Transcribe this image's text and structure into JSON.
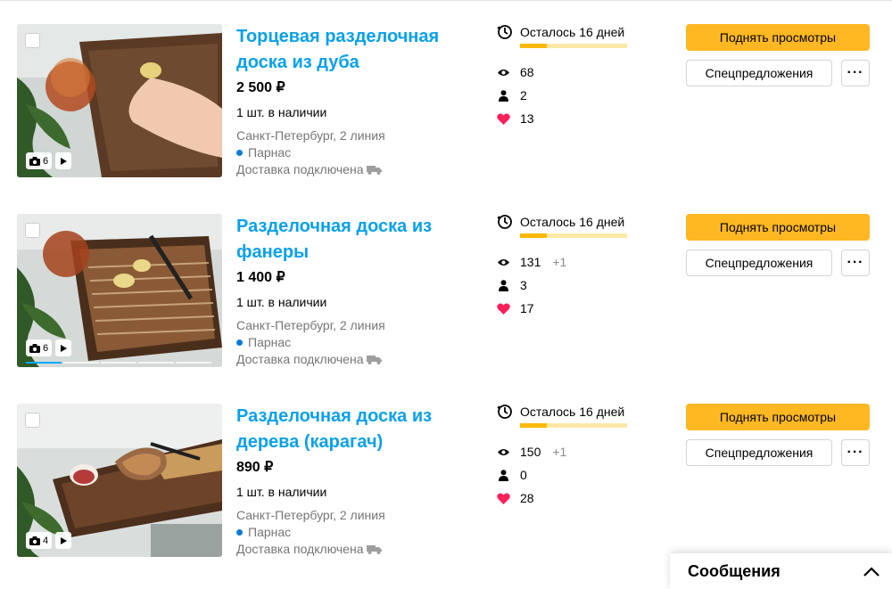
{
  "listings": [
    {
      "title": "Торцевая разделочная доска из дуба",
      "price": "2 500 ₽",
      "quantity": "1 шт. в наличии",
      "location": "Санкт-Петербург, 2 линия",
      "metro": "Парнас",
      "delivery": "Доставка подключена",
      "photo_count": "6",
      "days_left": "Осталось 16 дней",
      "days_progress": 0.25,
      "views": "68",
      "views_delta": "",
      "contacts": "2",
      "favorites": "13",
      "promote_label": "Поднять просмотры",
      "offers_label": "Спецпредложения",
      "more_label": "···"
    },
    {
      "title": "Разделочная доска из фанеры",
      "price": "1 400 ₽",
      "quantity": "1 шт. в наличии",
      "location": "Санкт-Петербург, 2 линия",
      "metro": "Парнас",
      "delivery": "Доставка подключена",
      "photo_count": "6",
      "days_left": "Осталось 16 дней",
      "days_progress": 0.25,
      "views": "131",
      "views_delta": "+1",
      "contacts": "3",
      "favorites": "17",
      "promote_label": "Поднять просмотры",
      "offers_label": "Спецпредложения",
      "more_label": "···"
    },
    {
      "title": "Разделочная доска из дерева (карагач)",
      "price": "890 ₽",
      "quantity": "1 шт. в наличии",
      "location": "Санкт-Петербург, 2 линия",
      "metro": "Парнас",
      "delivery": "Доставка подключена",
      "photo_count": "4",
      "days_left": "Осталось 16 дней",
      "days_progress": 0.25,
      "views": "150",
      "views_delta": "+1",
      "contacts": "0",
      "favorites": "28",
      "promote_label": "Поднять просмотры",
      "offers_label": "Спецпредложения",
      "more_label": "···"
    }
  ],
  "messages": {
    "title": "Сообщения"
  },
  "colors": {
    "title_link": "#0aa0e8",
    "promote_button": "#ffb821",
    "days_bar_fill": "#ffb800",
    "days_bar_track": "#fde9a6",
    "heart": "#ff1f5b",
    "metro_line": "#0a7bd6"
  },
  "icons": {
    "camera": "camera-icon",
    "play": "play-icon",
    "timer": "timer-icon",
    "eye": "eye-icon",
    "person": "person-icon",
    "heart": "heart-icon",
    "truck": "truck-icon",
    "chevron": "chevron-up-icon"
  }
}
